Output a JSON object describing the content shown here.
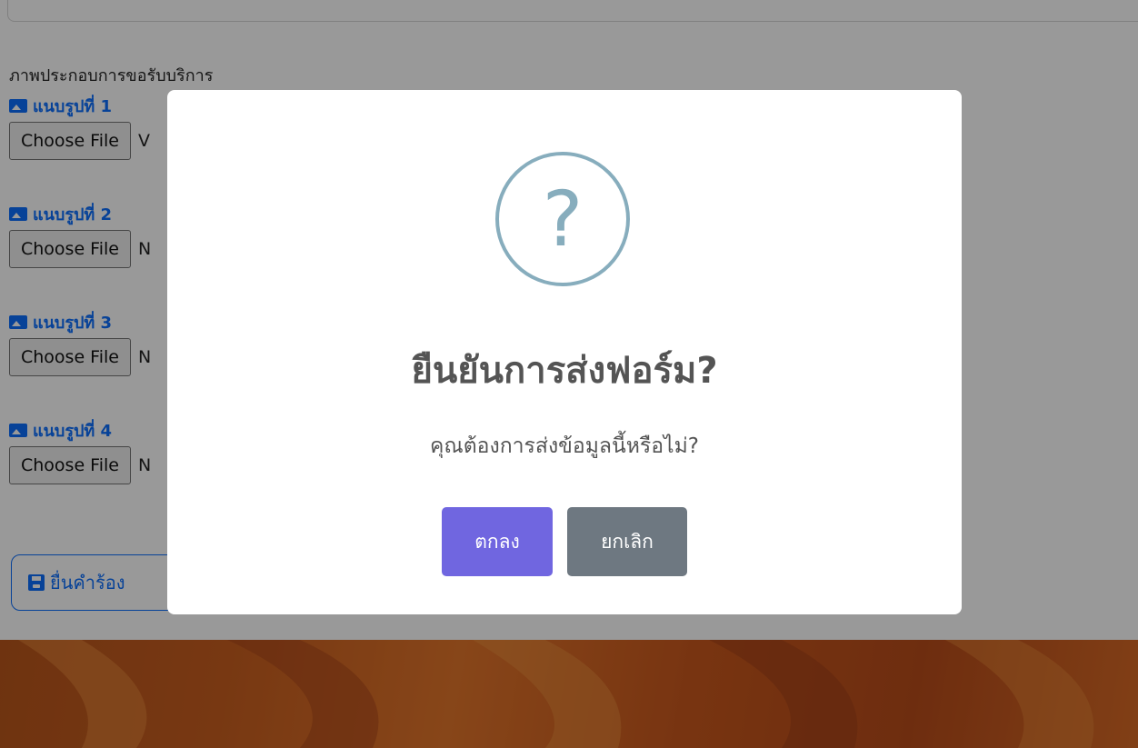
{
  "form": {
    "section_label": "ภาพประกอบการขอรับบริการ",
    "attachments": [
      {
        "label": "แนบรูปที่ 1",
        "button": "Choose File",
        "status": "V"
      },
      {
        "label": "แนบรูปที่ 2",
        "button": "Choose File",
        "status": "N"
      },
      {
        "label": "แนบรูปที่ 3",
        "button": "Choose File",
        "status": "N"
      },
      {
        "label": "แนบรูปที่ 4",
        "button": "Choose File",
        "status": "N"
      }
    ],
    "submit_label": "ยื่นคำร้อง"
  },
  "modal": {
    "icon_glyph": "?",
    "icon": "question-icon",
    "title": "ยืนยันการส่งฟอร์ม?",
    "text": "คุณต้องการส่งข้อมูลนี้หรือไม่?",
    "confirm_label": "ตกลง",
    "cancel_label": "ยกเลิก"
  },
  "colors": {
    "link_blue": "#0d6efd",
    "confirm": "#7066e0",
    "cancel": "#6e7881",
    "question_icon": "#87adbd",
    "footer_orange": "#c85e1f"
  }
}
